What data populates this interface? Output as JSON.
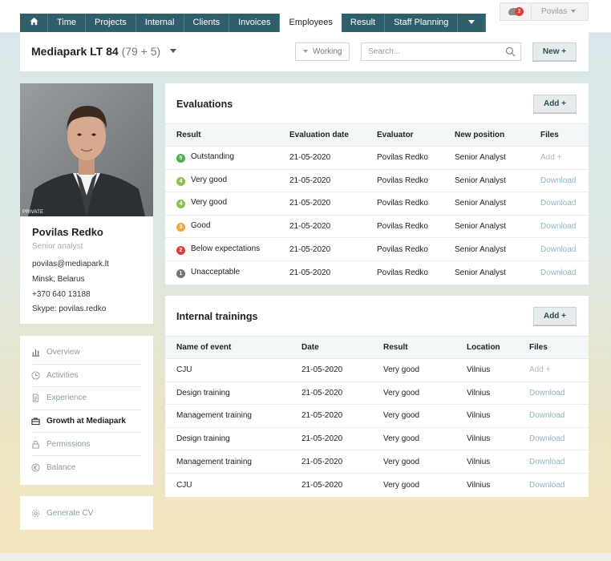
{
  "nav_tabs": [
    {
      "label": "Time"
    },
    {
      "label": "Projects"
    },
    {
      "label": "Internal"
    },
    {
      "label": "Clients"
    },
    {
      "label": "Invoices"
    },
    {
      "label": "Employees",
      "active": true
    },
    {
      "label": "Result"
    },
    {
      "label": "Staff Planning"
    }
  ],
  "user_menu": {
    "notification_count": "3",
    "user_name": "Povilas"
  },
  "header": {
    "company": "Mediapark LT 84",
    "count": "(79 + 5)",
    "status_filter": "Working",
    "search_placeholder": "Search...",
    "new_button": "New +"
  },
  "profile": {
    "photo_tag": "PRIVATE",
    "name": "Povilas Redko",
    "title": "Senior analyst",
    "email": "povilas@mediapark.lt",
    "location": "Minsk, Belarus",
    "phone": "+370 640 13188",
    "skype": "Skype: povilas.redko"
  },
  "sidebar": {
    "items": [
      {
        "label": "Overview",
        "icon": "bar-chart-icon"
      },
      {
        "label": "Activities",
        "icon": "clock-icon"
      },
      {
        "label": "Experience",
        "icon": "document-icon"
      },
      {
        "label": "Growth at Mediapark",
        "icon": "briefcase-icon",
        "active": true
      },
      {
        "label": "Permissions",
        "icon": "lock-icon"
      },
      {
        "label": "Balance",
        "icon": "euro-icon"
      }
    ],
    "generate_cv": "Generate CV"
  },
  "evaluations": {
    "title": "Evaluations",
    "add_button": "Add +",
    "columns": [
      "Result",
      "Evaluation date",
      "Evaluator",
      "New position",
      "Files"
    ],
    "rows": [
      {
        "score": "5",
        "color": "#4caf50",
        "result": "Outstanding",
        "date": "21-05-2020",
        "evaluator": "Povilas Redko",
        "position": "Senior Analyst",
        "file": "Add +"
      },
      {
        "score": "4",
        "color": "#8bc34a",
        "result": "Very good",
        "date": "21-05-2020",
        "evaluator": "Povilas Redko",
        "position": "Senior Analyst",
        "file": "Download"
      },
      {
        "score": "4",
        "color": "#8bc34a",
        "result": "Very good",
        "date": "21-05-2020",
        "evaluator": "Povilas Redko",
        "position": "Senior Analyst",
        "file": "Download"
      },
      {
        "score": "3",
        "color": "#f0a43a",
        "result": "Good",
        "date": "21-05-2020",
        "evaluator": "Povilas Redko",
        "position": "Senior Analyst",
        "file": "Download"
      },
      {
        "score": "2",
        "color": "#e53935",
        "result": "Below expectations",
        "date": "21-05-2020",
        "evaluator": "Povilas Redko",
        "position": "Senior Analyst",
        "file": "Download"
      },
      {
        "score": "1",
        "color": "#757575",
        "result": "Unacceptable",
        "date": "21-05-2020",
        "evaluator": "Povilas Redko",
        "position": "Senior Analyst",
        "file": "Download"
      }
    ]
  },
  "trainings": {
    "title": "Internal trainings",
    "add_button": "Add +",
    "columns": [
      "Name of event",
      "Date",
      "Result",
      "Location",
      "Files"
    ],
    "rows": [
      {
        "name": "CJU",
        "date": "21-05-2020",
        "result": "Very good",
        "location": "Vilnius",
        "file": "Add +"
      },
      {
        "name": "Design training",
        "date": "21-05-2020",
        "result": "Very good",
        "location": "Vilnius",
        "file": "Download"
      },
      {
        "name": "Management training",
        "date": "21-05-2020",
        "result": "Very good",
        "location": "Vilnius",
        "file": "Download"
      },
      {
        "name": "Design training",
        "date": "21-05-2020",
        "result": "Very good",
        "location": "Vilnius",
        "file": "Download"
      },
      {
        "name": "Management training",
        "date": "21-05-2020",
        "result": "Very good",
        "location": "Vilnius",
        "file": "Download"
      },
      {
        "name": "CJU",
        "date": "21-05-2020",
        "result": "Very good",
        "location": "Vilnius",
        "file": "Download"
      }
    ]
  }
}
